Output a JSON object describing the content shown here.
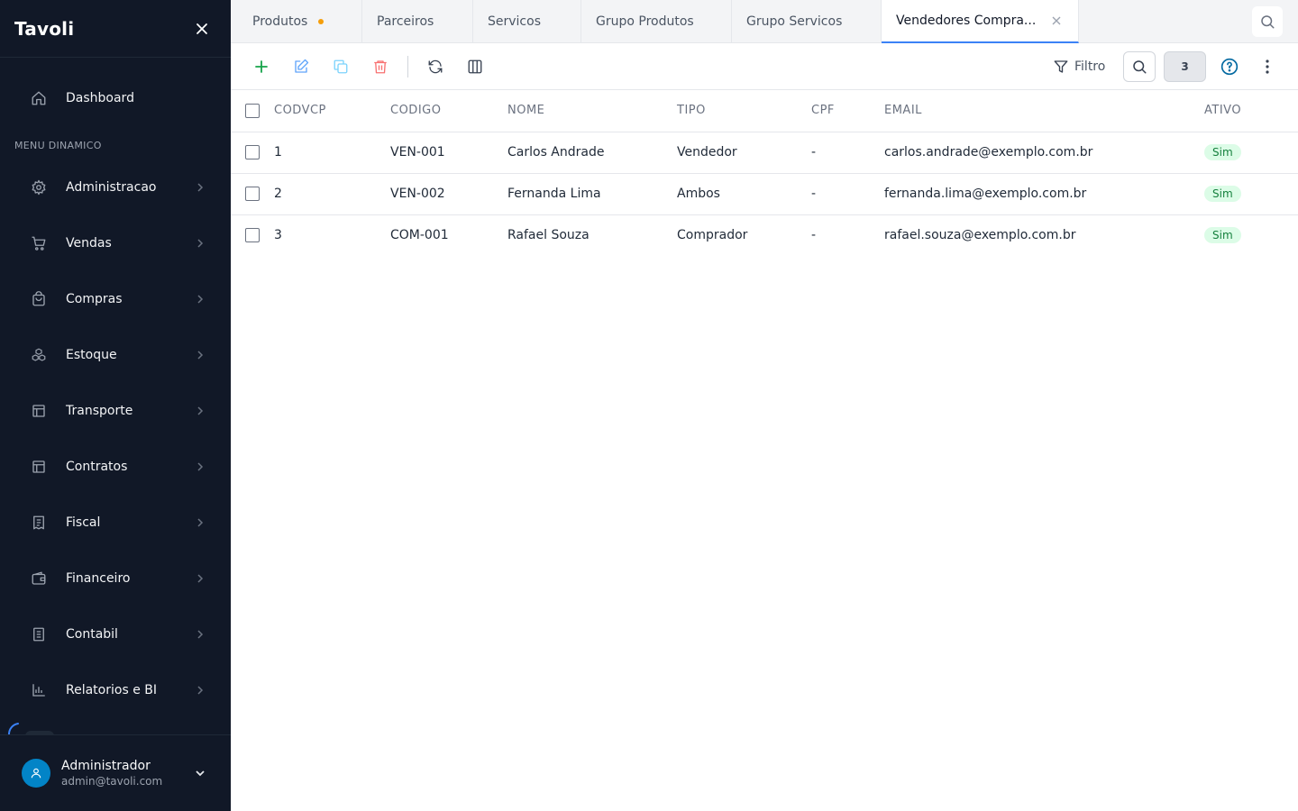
{
  "app": {
    "title": "Tavoli"
  },
  "sidebar": {
    "dashboard": "Dashboard",
    "section_label": "MENU DINAMICO",
    "items": [
      {
        "label": "Administracao",
        "icon": "gear-icon"
      },
      {
        "label": "Vendas",
        "icon": "cart-icon"
      },
      {
        "label": "Compras",
        "icon": "bag-icon"
      },
      {
        "label": "Estoque",
        "icon": "boxes-icon"
      },
      {
        "label": "Transporte",
        "icon": "layout-icon"
      },
      {
        "label": "Contratos",
        "icon": "layout-icon"
      },
      {
        "label": "Fiscal",
        "icon": "receipt-icon"
      },
      {
        "label": "Financeiro",
        "icon": "wallet-icon"
      },
      {
        "label": "Contabil",
        "icon": "book-icon"
      },
      {
        "label": "Relatorios e BI",
        "icon": "bar-chart-icon"
      }
    ],
    "user": {
      "name": "Administrador",
      "email": "admin@tavoli.com"
    }
  },
  "tabs": [
    {
      "label": "Produtos",
      "modified": true
    },
    {
      "label": "Parceiros"
    },
    {
      "label": "Servicos"
    },
    {
      "label": "Grupo Produtos"
    },
    {
      "label": "Grupo Servicos"
    },
    {
      "label": "Vendedores Compra...",
      "active": true
    }
  ],
  "toolbar": {
    "filter_label": "Filtro",
    "record_count": "3"
  },
  "table": {
    "columns": [
      "CODVCP",
      "CODIGO",
      "NOME",
      "TIPO",
      "CPF",
      "EMAIL",
      "ATIVO"
    ],
    "rows": [
      [
        "1",
        "VEN-001",
        "Carlos Andrade",
        "Vendedor",
        "-",
        "carlos.andrade@exemplo.com.br",
        "Sim"
      ],
      [
        "2",
        "VEN-002",
        "Fernanda Lima",
        "Ambos",
        "-",
        "fernanda.lima@exemplo.com.br",
        "Sim"
      ],
      [
        "3",
        "COM-001",
        "Rafael Souza",
        "Comprador",
        "-",
        "rafael.souza@exemplo.com.br",
        "Sim"
      ]
    ]
  },
  "colors": {
    "sidebar_bg": "#111827",
    "accent": "#3b82f6",
    "active_badge_bg": "#dcfce7",
    "active_badge_text": "#15803d"
  }
}
